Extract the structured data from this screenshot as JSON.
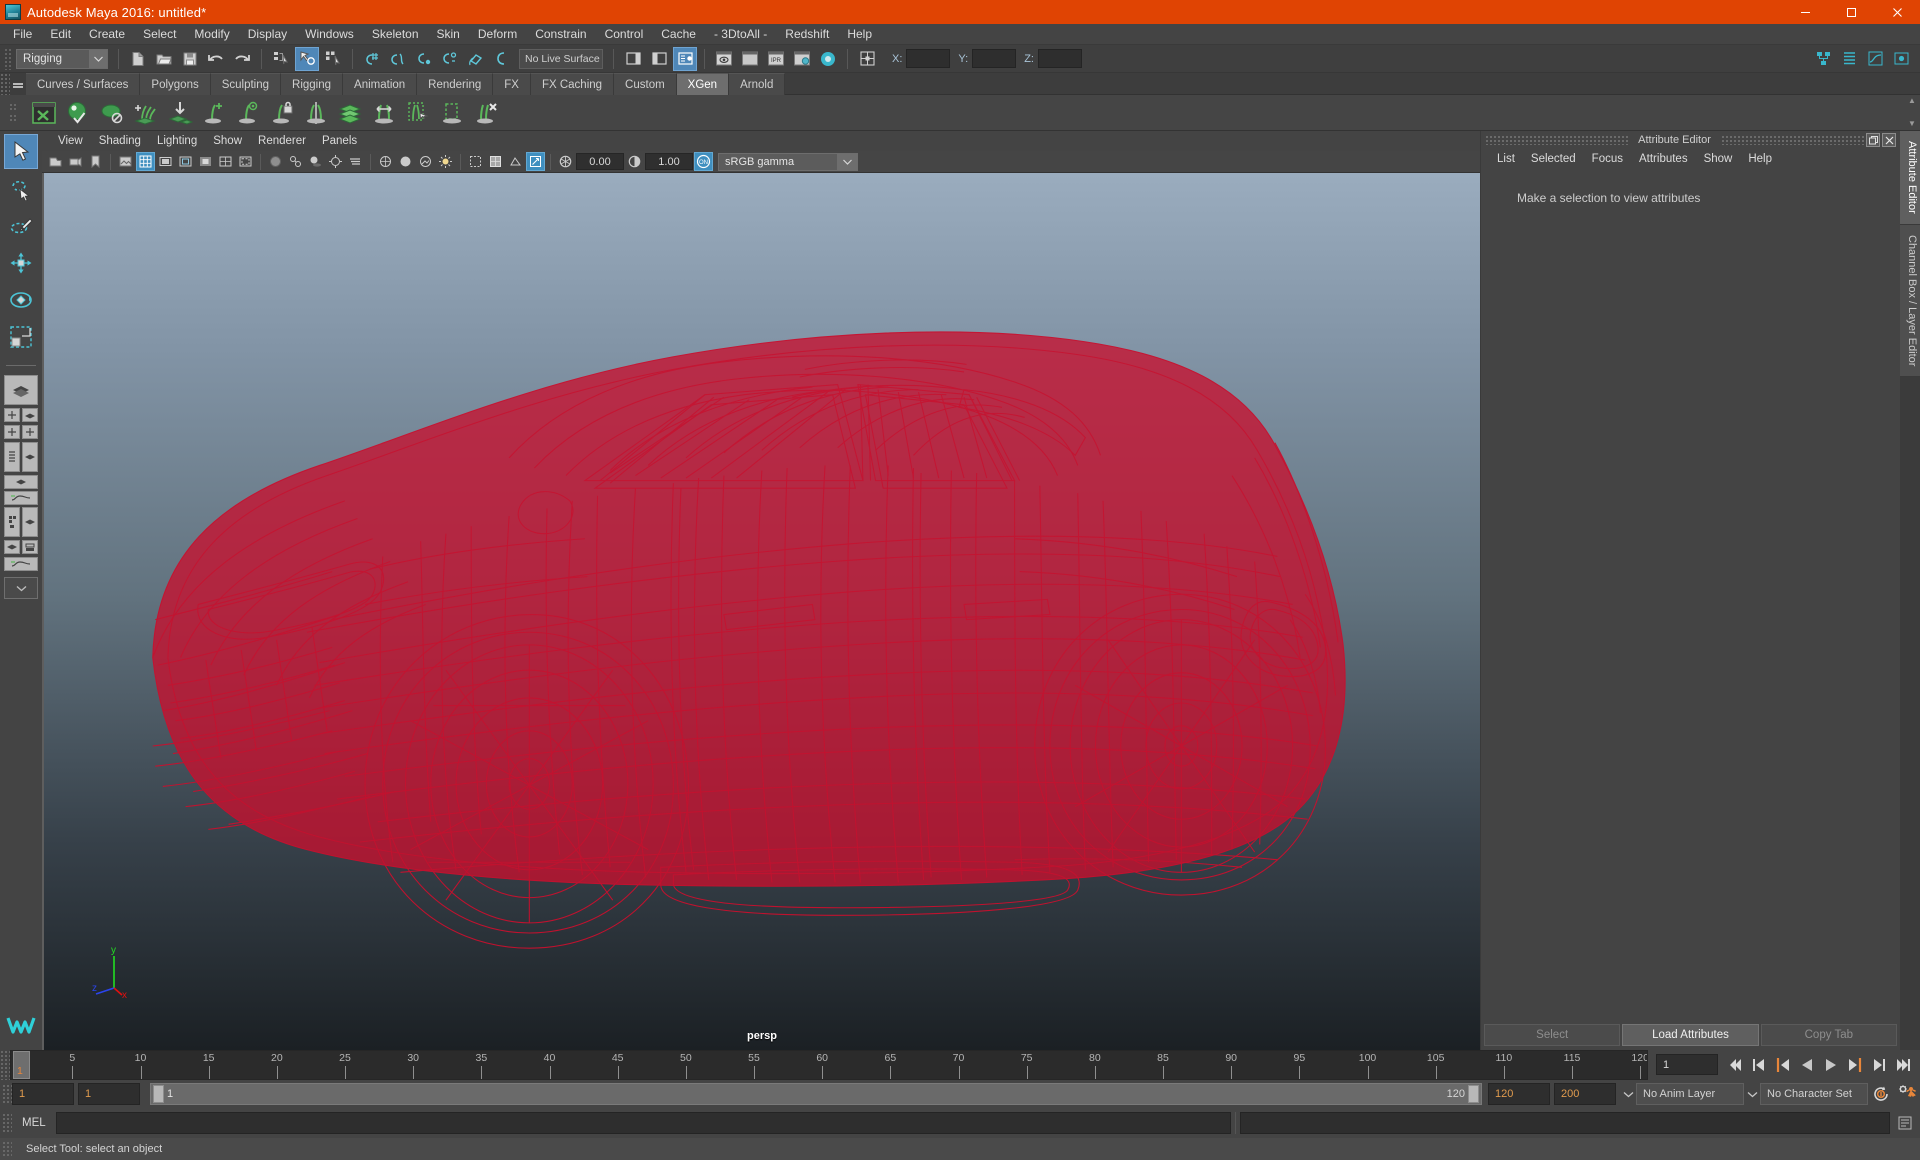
{
  "window": {
    "title": "Autodesk Maya 2016: untitled*",
    "app_icon": "maya-logo-icon",
    "controls": {
      "minimize": "minimize-icon",
      "maximize": "maximize-icon",
      "close": "close-icon"
    },
    "accent_color": "#e04403"
  },
  "menubar": {
    "items": [
      "File",
      "Edit",
      "Create",
      "Select",
      "Modify",
      "Display",
      "Windows",
      "Skeleton",
      "Skin",
      "Deform",
      "Constrain",
      "Control",
      "Cache",
      "- 3DtoAll -",
      "Redshift",
      "Help"
    ]
  },
  "toolbar": {
    "menuset": "Rigging",
    "file_icons": [
      "new-scene-icon",
      "open-scene-icon",
      "save-scene-icon"
    ],
    "history_icons": [
      "undo-icon",
      "redo-icon"
    ],
    "selection_icons": [
      "select-by-hierarchy-icon",
      "select-by-object-icon",
      "select-by-component-icon"
    ],
    "snap_icons": [
      "snap-to-grid-icon",
      "snap-to-curve-icon",
      "snap-to-point-icon",
      "snap-to-projected-center-icon",
      "snap-to-view-plane-icon",
      "make-live-icon"
    ],
    "live_surface": "No Live Surface",
    "editor_icons": [
      "show-hide-attribute-editor-icon",
      "show-hide-tool-settings-icon",
      "show-hide-channel-box-icon"
    ],
    "render_icons": [
      "render-current-frame-icon",
      "render-sequence-icon",
      "ipr-render-icon",
      "render-settings-icon",
      "render-view-icon"
    ],
    "coordinate_label": "absolute-transform-icon",
    "axes": [
      {
        "label": "X:",
        "value": ""
      },
      {
        "label": "Y:",
        "value": ""
      },
      {
        "label": "Z:",
        "value": ""
      }
    ]
  },
  "shelf": {
    "tabs": [
      "Curves / Surfaces",
      "Polygons",
      "Sculpting",
      "Rigging",
      "Animation",
      "Rendering",
      "FX",
      "FX Caching",
      "Custom",
      "XGen",
      "Arnold"
    ],
    "active_tab": "XGen",
    "icons": [
      "xgen-window-icon",
      "xgen-preview-icon",
      "xgen-sphere-icon",
      "xgen-add-guide-icon",
      "xgen-place-icon",
      "xgen-add-attribute-icon",
      "xgen-guide-eye-icon",
      "xgen-lock-icon",
      "xgen-mirror-icon",
      "xgen-layers-icon",
      "xgen-spread-icon",
      "xgen-select-guides-icon",
      "xgen-region-icon",
      "xgen-delete-guide-icon"
    ],
    "icon_color": "#5bb85b"
  },
  "toolbox": {
    "tools": [
      {
        "name": "select-tool",
        "active": true
      },
      {
        "name": "lasso-select-tool",
        "active": false
      },
      {
        "name": "paint-select-tool",
        "active": false
      },
      {
        "name": "move-tool",
        "active": false
      },
      {
        "name": "rotate-tool",
        "active": false
      },
      {
        "name": "scale-tool",
        "active": false
      }
    ],
    "layouts": [
      "single-perspective-layout",
      "four-view-layout",
      "outliner-persp-layout",
      "persp-graph-layout",
      "hypershade-persp-layout",
      "persp-graph-outliner-layout",
      "more-layouts"
    ]
  },
  "viewport": {
    "menus": [
      "View",
      "Shading",
      "Lighting",
      "Show",
      "Renderer",
      "Panels"
    ],
    "exposure": "0.00",
    "gamma": "1.00",
    "gamma_toggle": "ON",
    "color_space": "sRGB gamma",
    "camera_label": "persp",
    "axis_labels": {
      "x": "x",
      "y": "y",
      "z": "z"
    },
    "axis_colors": {
      "x": "#e01010",
      "y": "#22dd22",
      "z": "#2b44ee"
    },
    "model_color": "#c8102e",
    "icons": [
      "select-camera-icon",
      "lock-camera-icon",
      "bookmark-icon",
      "image-plane-icon",
      "grid-toggle-icon",
      "film-gate-icon",
      "resolution-gate-icon",
      "gate-mask-icon",
      "field-chart-icon",
      "safe-action-icon",
      "safe-title-icon",
      "xray-icon",
      "xray-joints-icon",
      "shadows-icon",
      "ambient-occlusion-icon",
      "motion-blur-icon",
      "wireframe-icon",
      "smooth-shade-icon",
      "hardware-texturing-icon",
      "use-lights-icon",
      "isolate-select-icon",
      "wireframe-on-shaded-icon",
      "smooth-wireframe-icon",
      "exposure-icon",
      "contrast-icon"
    ]
  },
  "attribute_editor": {
    "panel_title": "Attribute Editor",
    "menus": [
      "List",
      "Selected",
      "Focus",
      "Attributes",
      "Show",
      "Help"
    ],
    "empty_message": "Make a selection to view attributes",
    "window_controls": [
      "undock-icon",
      "close-icon"
    ],
    "buttons": [
      {
        "label": "Select",
        "enabled": false
      },
      {
        "label": "Load Attributes",
        "enabled": true
      },
      {
        "label": "Copy Tab",
        "enabled": false
      }
    ]
  },
  "vertical_tabs": {
    "items": [
      {
        "label": "Attribute Editor",
        "active": true
      },
      {
        "label": "Channel Box / Layer Editor",
        "active": false
      }
    ]
  },
  "timeline": {
    "start": 1,
    "end": 120,
    "current_frame": "1",
    "tick_labels": [
      "5",
      "10",
      "15",
      "20",
      "25",
      "30",
      "35",
      "40",
      "45",
      "50",
      "55",
      "60",
      "65",
      "70",
      "75",
      "80",
      "85",
      "90",
      "95",
      "100",
      "105",
      "110",
      "115",
      "120"
    ],
    "tick_values": [
      5,
      10,
      15,
      20,
      25,
      30,
      35,
      40,
      45,
      50,
      55,
      60,
      65,
      70,
      75,
      80,
      85,
      90,
      95,
      100,
      105,
      110,
      115,
      120
    ],
    "current_marker_color": "#e8863a",
    "transport": [
      "go-to-start-icon",
      "step-back-keyframe-icon",
      "step-back-frame-icon",
      "play-backwards-icon",
      "play-forwards-icon",
      "step-forward-frame-icon",
      "step-forward-keyframe-icon",
      "go-to-end-icon"
    ]
  },
  "range_slider": {
    "anim_start": "1",
    "range_start": "1",
    "bar_start": "1",
    "bar_end": "120",
    "range_end": "120",
    "anim_end": "200",
    "anim_layer": "No Anim Layer",
    "character_set": "No Character Set",
    "icons": [
      "auto-key-icon",
      "animation-preferences-icon"
    ]
  },
  "command_line": {
    "language": "MEL",
    "input_value": "",
    "output_value": "",
    "script_editor_icon": "script-editor-icon"
  },
  "status": {
    "message": "Select Tool: select an object"
  }
}
